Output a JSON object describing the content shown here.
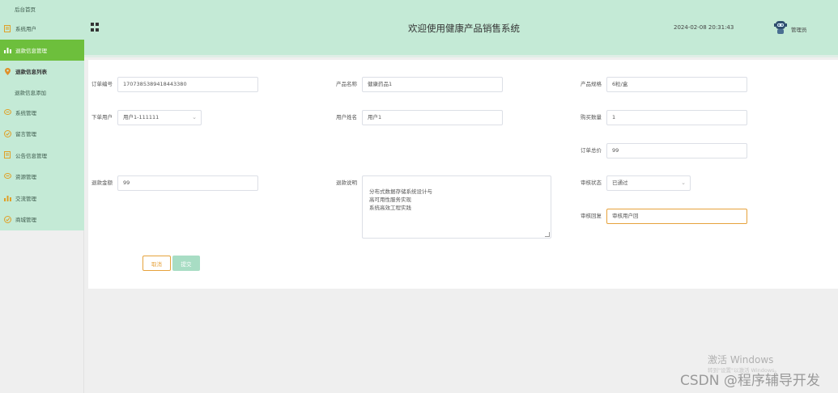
{
  "header": {
    "title": "欢迎使用健康产品销售系统",
    "datetime": "2024-02-08 20:31:43",
    "username": "管理员"
  },
  "sidebar": {
    "items": [
      {
        "label": "后台首页",
        "icon": "none"
      },
      {
        "label": "系统用户",
        "icon": "document-icon"
      },
      {
        "label": "退款信息管理",
        "icon": "bar-chart-icon"
      },
      {
        "label": "退款信息列表",
        "icon": "location-pin-icon"
      },
      {
        "label": "退款信息添加",
        "icon": "none"
      },
      {
        "label": "系统管理",
        "icon": "chat-icon"
      },
      {
        "label": "留言管理",
        "icon": "check-circle-icon"
      },
      {
        "label": "公告信息管理",
        "icon": "document-icon"
      },
      {
        "label": "资源管理",
        "icon": "chat-icon"
      },
      {
        "label": "交流管理",
        "icon": "bar-chart-icon"
      },
      {
        "label": "商城管理",
        "icon": "check-circle-icon"
      }
    ]
  },
  "form": {
    "order_no": {
      "label": "订单编号",
      "value": "1707385389418443380"
    },
    "product_name": {
      "label": "产品名称",
      "value": "健康药品1"
    },
    "product_spec": {
      "label": "产品规格",
      "value": "6粒/盒"
    },
    "order_user": {
      "label": "下单用户",
      "value": "用户1-111111"
    },
    "user_name": {
      "label": "用户姓名",
      "value": "用户1"
    },
    "purchase_qty": {
      "label": "购买数量",
      "value": "1"
    },
    "order_total": {
      "label": "订单总价",
      "value": "99"
    },
    "refund_amount": {
      "label": "退款金额",
      "value": "99"
    },
    "refund_reason": {
      "label": "退款说明",
      "value": "分布式数据存储系统设计与\n高可用性服务实现\n系统高效工程实践"
    },
    "review_status": {
      "label": "审核状态",
      "value": "已通过"
    },
    "review_reply": {
      "label": "审核回复",
      "value": "审核用户回"
    }
  },
  "buttons": {
    "cancel": "取消",
    "submit": "提交"
  },
  "watermarks": {
    "windows_title": "激活 Windows",
    "windows_sub": "转到\"设置\"以激活 Windows。",
    "csdn": "CSDN @程序辅导开发"
  },
  "colors": {
    "header_bg": "#c4ead6",
    "active_menu": "#6dbf3c",
    "accent_orange": "#e6a23c"
  }
}
